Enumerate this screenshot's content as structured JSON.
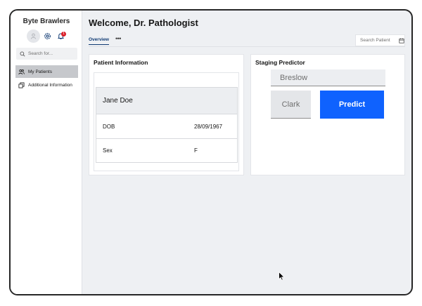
{
  "app": {
    "brand": "Byte Brawlers"
  },
  "sidebar": {
    "search_placeholder": "Search for...",
    "notification_count": "1",
    "items": [
      {
        "label": "My Patients",
        "icon": "users-icon",
        "active": true
      },
      {
        "label": "Additional Information",
        "icon": "copy-icon",
        "active": false
      }
    ]
  },
  "header": {
    "title": "Welcome, Dr. Pathologist",
    "tabs": [
      {
        "label": "Overview"
      }
    ],
    "more_label": "•••",
    "search_placeholder": "Search Patient"
  },
  "patient_card": {
    "title": "Patient Information",
    "name": "Jane Doe",
    "rows": [
      {
        "key": "DOB",
        "value": "28/09/1967"
      },
      {
        "key": "Sex",
        "value": "F"
      }
    ]
  },
  "staging_card": {
    "title": "Staging Predictor",
    "breslow_placeholder": "Breslow",
    "clark_label": "Clark",
    "predict_label": "Predict"
  },
  "colors": {
    "accent": "#0f62fe",
    "tab_active": "#0f3a73",
    "badge": "#da1e28",
    "background": "#eef0f3"
  }
}
